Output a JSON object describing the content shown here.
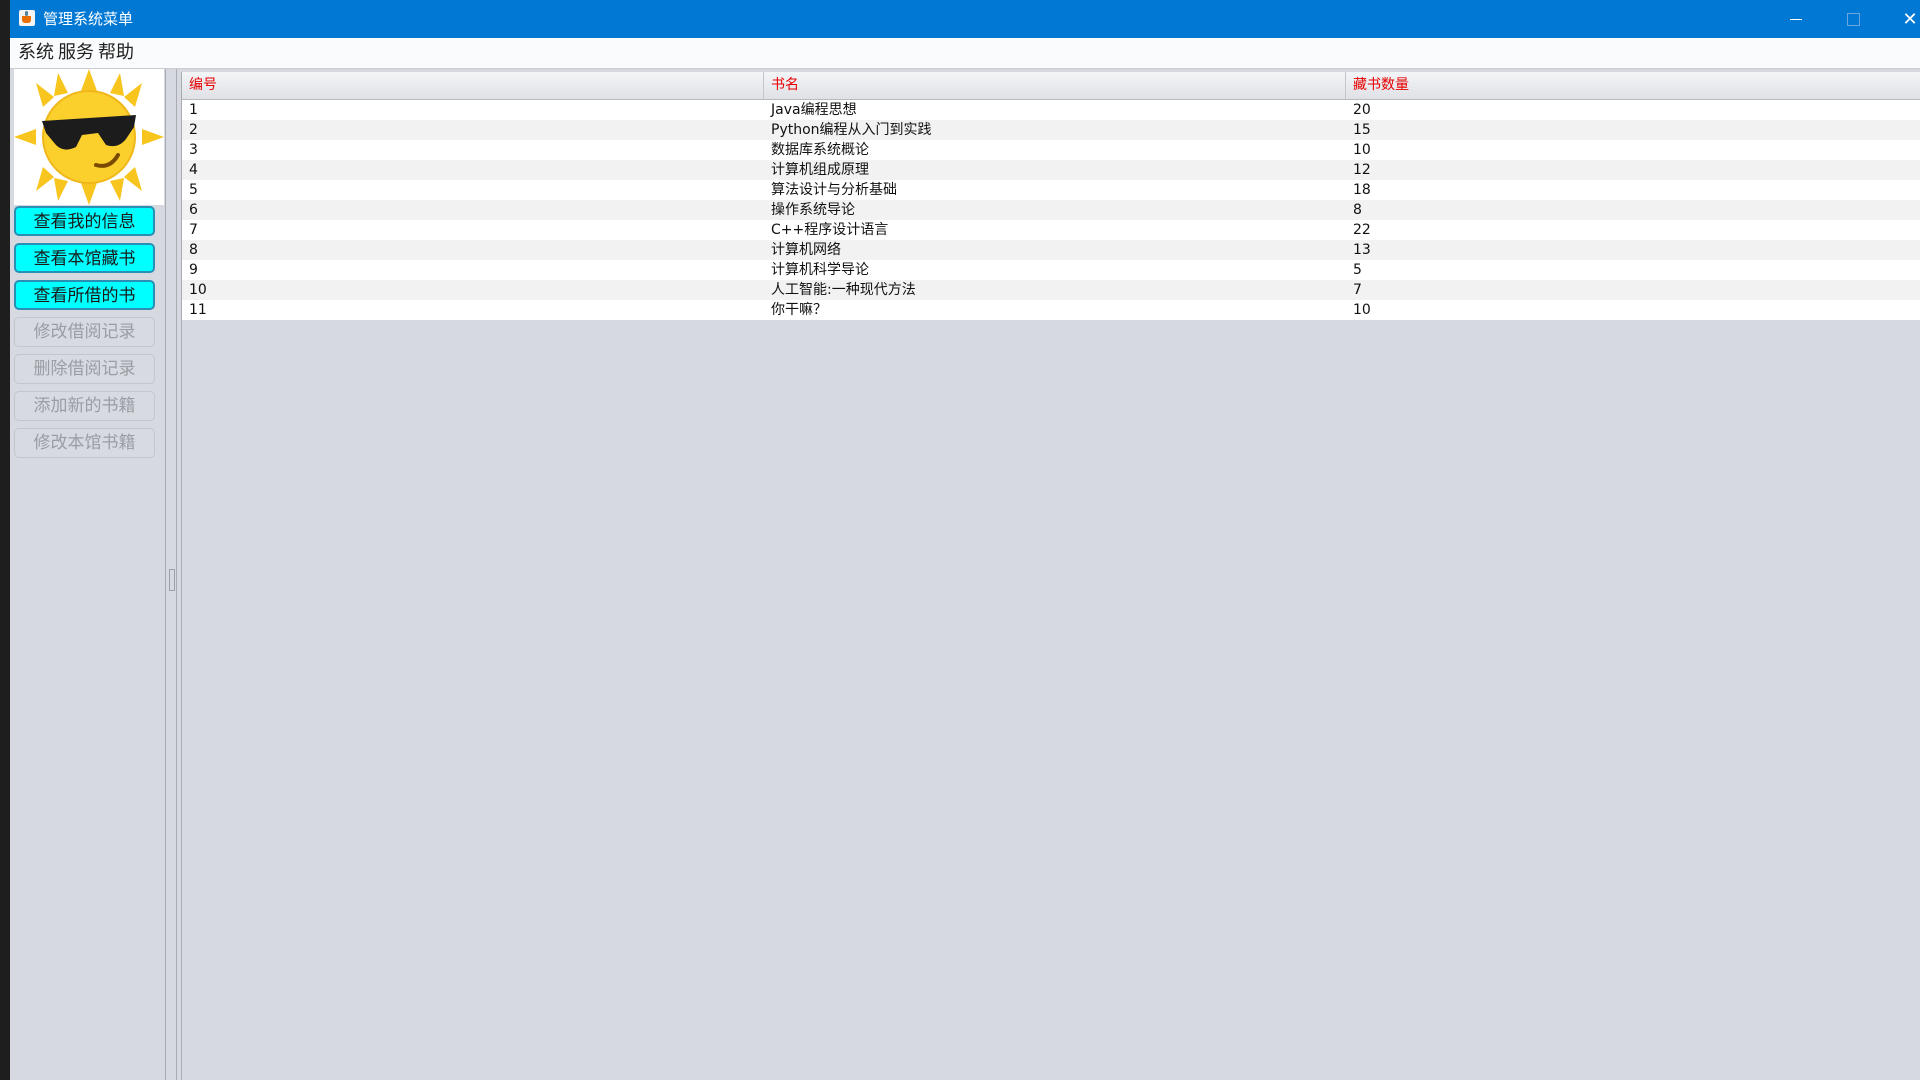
{
  "window": {
    "title": "管理系统菜单",
    "controls": {
      "minimize": "minimize",
      "maximize": "maximize",
      "close": "✕"
    }
  },
  "menubar": {
    "items": [
      "系统",
      "服务",
      "帮助"
    ]
  },
  "sidebar": {
    "buttons": [
      {
        "label": "查看我的信息",
        "enabled": true
      },
      {
        "label": "查看本馆藏书",
        "enabled": true
      },
      {
        "label": "查看所借的书",
        "enabled": true
      },
      {
        "label": "修改借阅记录",
        "enabled": false
      },
      {
        "label": "删除借阅记录",
        "enabled": false
      },
      {
        "label": "添加新的书籍",
        "enabled": false
      },
      {
        "label": "修改本馆书籍",
        "enabled": false
      }
    ]
  },
  "table": {
    "columns": [
      "编号",
      "书名",
      "藏书数量"
    ],
    "rows": [
      [
        "1",
        "Java编程思想",
        "20"
      ],
      [
        "2",
        "Python编程从入门到实践",
        "15"
      ],
      [
        "3",
        "数据库系统概论",
        "10"
      ],
      [
        "4",
        "计算机组成原理",
        "12"
      ],
      [
        "5",
        "算法设计与分析基础",
        "18"
      ],
      [
        "6",
        "操作系统导论",
        "8"
      ],
      [
        "7",
        "C++程序设计语言",
        "22"
      ],
      [
        "8",
        "计算机网络",
        "13"
      ],
      [
        "9",
        "计算机科学导论",
        "5"
      ],
      [
        "10",
        "人工智能:一种现代方法",
        "7"
      ],
      [
        "11",
        "你干嘛？",
        "10"
      ]
    ]
  },
  "colors": {
    "titlebar": "#0078d4",
    "active_button": "#00ffff",
    "header_text": "#e60000"
  },
  "icons": [
    "java-cup-icon",
    "sun-sunglasses-avatar",
    "minimize-icon",
    "maximize-icon",
    "close-icon"
  ]
}
